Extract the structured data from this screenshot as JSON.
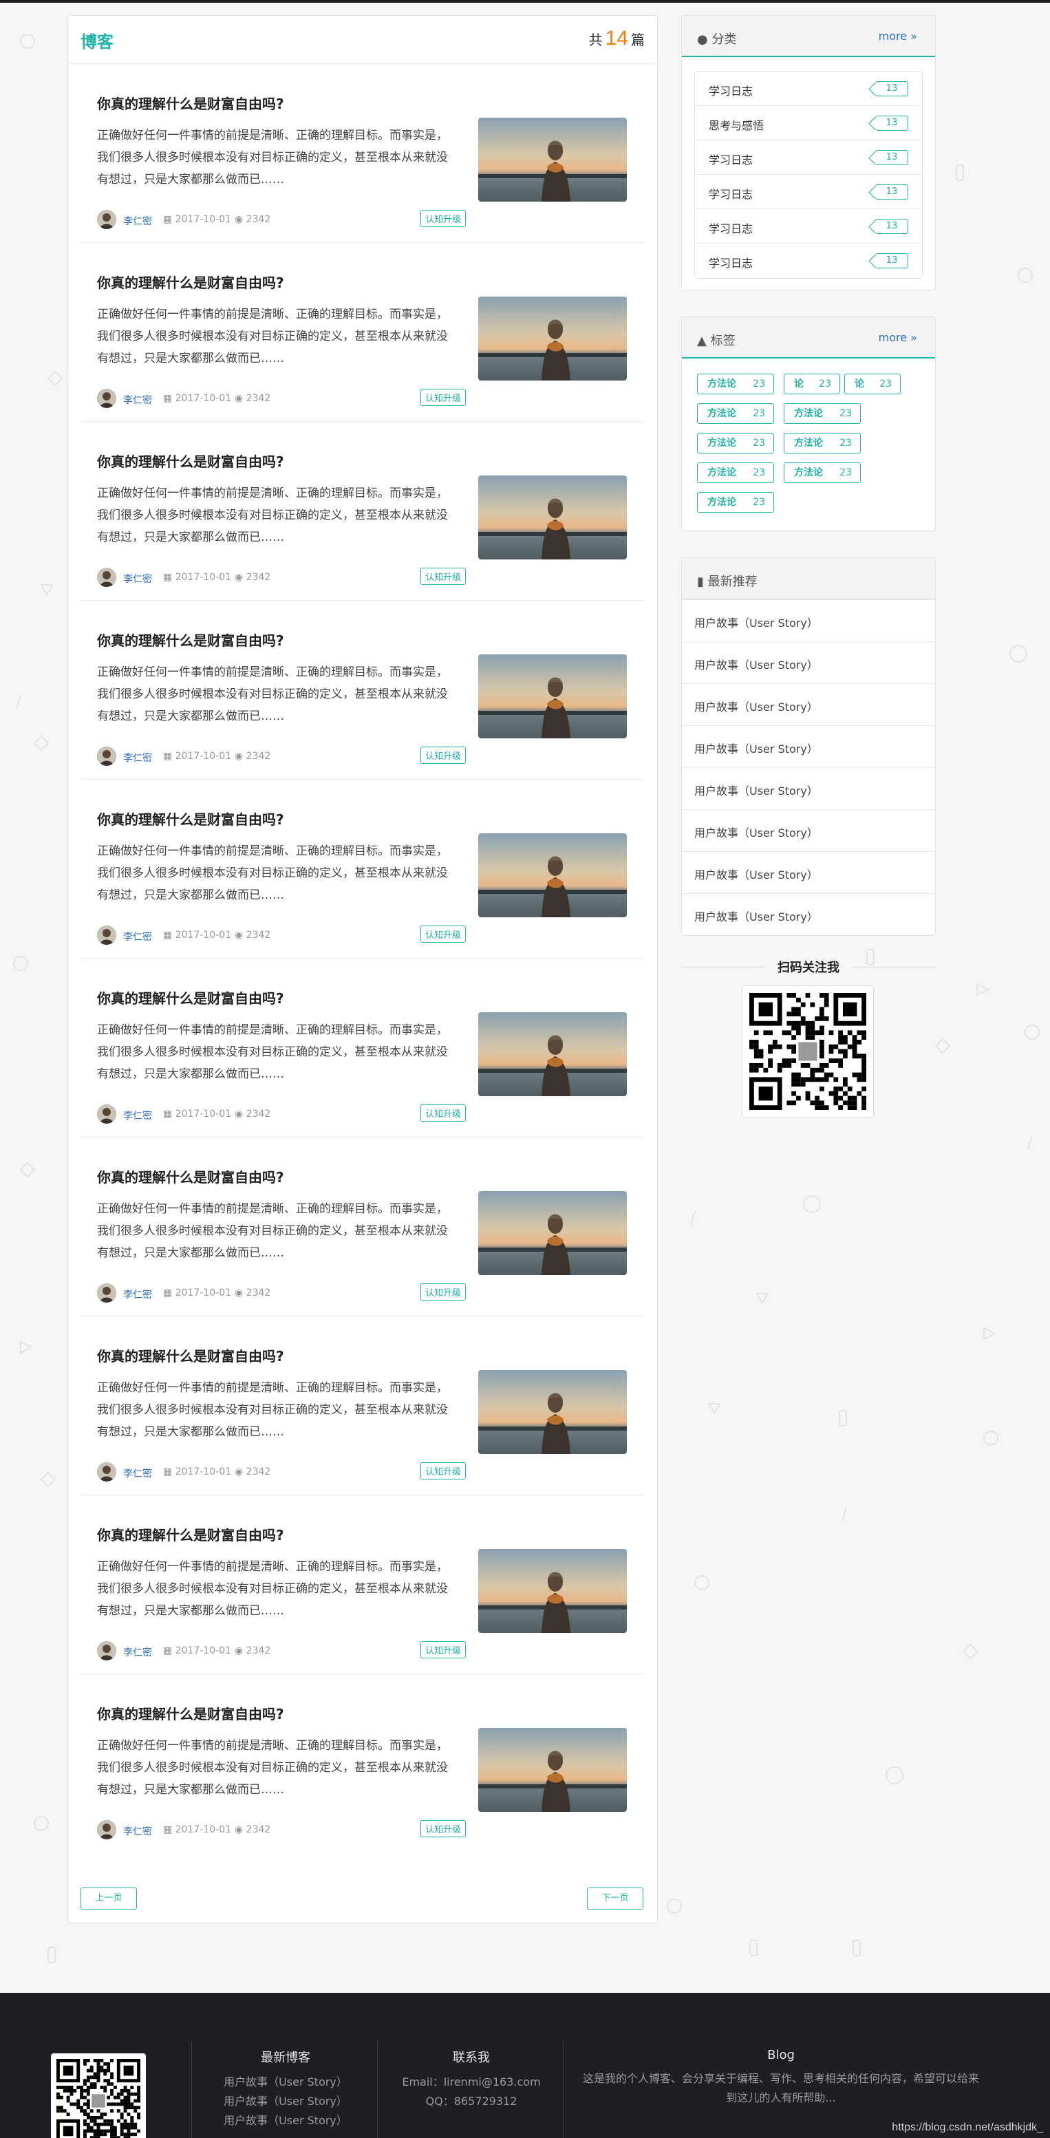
{
  "blog": {
    "title": "博客",
    "count_prefix": "共",
    "count": "14",
    "count_suffix": "篇"
  },
  "posts": [
    {
      "title": "你真的理解什么是财富自由吗?",
      "summary": "正确做好任何一件事情的前提是清晰、正确的理解目标。而事实是，我们很多人很多时候根本没有对目标正确的定义，甚至根本从来就没有想过，只是大家都那么做而已……",
      "author": "李仁密",
      "date": "2017-10-01",
      "views": "2342",
      "tag": "认知升级"
    },
    {
      "title": "你真的理解什么是财富自由吗?",
      "summary": "正确做好任何一件事情的前提是清晰、正确的理解目标。而事实是，我们很多人很多时候根本没有对目标正确的定义，甚至根本从来就没有想过，只是大家都那么做而已……",
      "author": "李仁密",
      "date": "2017-10-01",
      "views": "2342",
      "tag": "认知升级"
    },
    {
      "title": "你真的理解什么是财富自由吗?",
      "summary": "正确做好任何一件事情的前提是清晰、正确的理解目标。而事实是，我们很多人很多时候根本没有对目标正确的定义，甚至根本从来就没有想过，只是大家都那么做而已……",
      "author": "李仁密",
      "date": "2017-10-01",
      "views": "2342",
      "tag": "认知升级"
    },
    {
      "title": "你真的理解什么是财富自由吗?",
      "summary": "正确做好任何一件事情的前提是清晰、正确的理解目标。而事实是，我们很多人很多时候根本没有对目标正确的定义，甚至根本从来就没有想过，只是大家都那么做而已……",
      "author": "李仁密",
      "date": "2017-10-01",
      "views": "2342",
      "tag": "认知升级"
    },
    {
      "title": "你真的理解什么是财富自由吗?",
      "summary": "正确做好任何一件事情的前提是清晰、正确的理解目标。而事实是，我们很多人很多时候根本没有对目标正确的定义，甚至根本从来就没有想过，只是大家都那么做而已……",
      "author": "李仁密",
      "date": "2017-10-01",
      "views": "2342",
      "tag": "认知升级"
    },
    {
      "title": "你真的理解什么是财富自由吗?",
      "summary": "正确做好任何一件事情的前提是清晰、正确的理解目标。而事实是，我们很多人很多时候根本没有对目标正确的定义，甚至根本从来就没有想过，只是大家都那么做而已……",
      "author": "李仁密",
      "date": "2017-10-01",
      "views": "2342",
      "tag": "认知升级"
    },
    {
      "title": "你真的理解什么是财富自由吗?",
      "summary": "正确做好任何一件事情的前提是清晰、正确的理解目标。而事实是，我们很多人很多时候根本没有对目标正确的定义，甚至根本从来就没有想过，只是大家都那么做而已……",
      "author": "李仁密",
      "date": "2017-10-01",
      "views": "2342",
      "tag": "认知升级"
    },
    {
      "title": "你真的理解什么是财富自由吗?",
      "summary": "正确做好任何一件事情的前提是清晰、正确的理解目标。而事实是，我们很多人很多时候根本没有对目标正确的定义，甚至根本从来就没有想过，只是大家都那么做而已……",
      "author": "李仁密",
      "date": "2017-10-01",
      "views": "2342",
      "tag": "认知升级"
    },
    {
      "title": "你真的理解什么是财富自由吗?",
      "summary": "正确做好任何一件事情的前提是清晰、正确的理解目标。而事实是，我们很多人很多时候根本没有对目标正确的定义，甚至根本从来就没有想过，只是大家都那么做而已……",
      "author": "李仁密",
      "date": "2017-10-01",
      "views": "2342",
      "tag": "认知升级"
    },
    {
      "title": "你真的理解什么是财富自由吗?",
      "summary": "正确做好任何一件事情的前提是清晰、正确的理解目标。而事实是，我们很多人很多时候根本没有对目标正确的定义，甚至根本从来就没有想过，只是大家都那么做而已……",
      "author": "李仁密",
      "date": "2017-10-01",
      "views": "2342",
      "tag": "认知升级"
    }
  ],
  "pager": {
    "prev": "上一页",
    "next": "下一页"
  },
  "categories": {
    "title": "分类",
    "more": "more",
    "items": [
      {
        "label": "学习日志",
        "count": "13"
      },
      {
        "label": "思考与感悟",
        "count": "13"
      },
      {
        "label": "学习日志",
        "count": "13"
      },
      {
        "label": "学习日志",
        "count": "13"
      },
      {
        "label": "学习日志",
        "count": "13"
      },
      {
        "label": "学习日志",
        "count": "13"
      }
    ]
  },
  "tags": {
    "title": "标签",
    "more": "more",
    "items": [
      {
        "name": "方法论",
        "count": "23"
      },
      {
        "name": "论",
        "count": "23"
      },
      {
        "name": "论",
        "count": "23"
      },
      {
        "name": "方法论",
        "count": "23"
      },
      {
        "name": "方法论",
        "count": "23"
      },
      {
        "name": "方法论",
        "count": "23"
      },
      {
        "name": "方法论",
        "count": "23"
      },
      {
        "name": "方法论",
        "count": "23"
      },
      {
        "name": "方法论",
        "count": "23"
      },
      {
        "name": "方法论",
        "count": "23"
      }
    ]
  },
  "recommend": {
    "title": "最新推荐",
    "items": [
      "用户故事（User Story）",
      "用户故事（User Story）",
      "用户故事（User Story）",
      "用户故事（User Story）",
      "用户故事（User Story）",
      "用户故事（User Story）",
      "用户故事（User Story）",
      "用户故事（User Story）"
    ]
  },
  "qr": {
    "title": "扫码关注我"
  },
  "footer": {
    "latest_title": "最新博客",
    "latest": [
      "用户故事（User Story）",
      "用户故事（User Story）",
      "用户故事（User Story）"
    ],
    "contact_title": "联系我",
    "email": "Email：lirenmi@163.com",
    "qq": "QQ：865729312",
    "blog_title": "Blog",
    "blog_desc": "这是我的个人博客、会分享关于编程、写作、思考相关的任何内容，希望可以给来到这儿的人有所帮助...",
    "url": "https://blog.csdn.net/asdhkjdk_"
  },
  "colors": {
    "accent": "#1fb4a8",
    "count": "#ff7a00",
    "link": "#2e6fc6",
    "footer_bg": "#1f1f23"
  }
}
